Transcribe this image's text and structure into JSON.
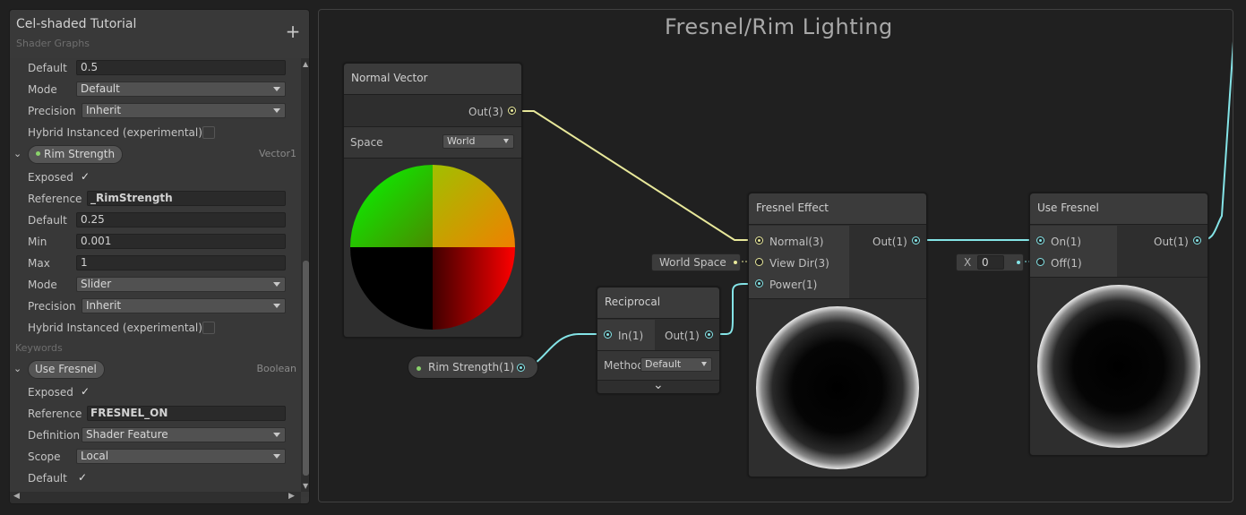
{
  "blackboard": {
    "title": "Cel-shaded Tutorial",
    "subtitle": "Shader Graphs",
    "add_icon": "+",
    "rows_top": {
      "default_label": "Default",
      "default_value": "0.5",
      "mode_label": "Mode",
      "mode_value": "Default",
      "precision_label": "Precision",
      "precision_value": "Inherit",
      "hybrid_label": "Hybrid Instanced (experimental)"
    },
    "rim_strength": {
      "name": "Rim Strength",
      "type": "Vector1",
      "exposed_label": "Exposed",
      "reference_label": "Reference",
      "reference_value": "_RimStrength",
      "default_label": "Default",
      "default_value": "0.25",
      "min_label": "Min",
      "min_value": "0.001",
      "max_label": "Max",
      "max_value": "1",
      "mode_label": "Mode",
      "mode_value": "Slider",
      "precision_label": "Precision",
      "precision_value": "Inherit",
      "hybrid_label": "Hybrid Instanced (experimental)"
    },
    "keywords_label": "Keywords",
    "use_fresnel": {
      "name": "Use Fresnel",
      "type": "Boolean",
      "exposed_label": "Exposed",
      "reference_label": "Reference",
      "reference_value": "FRESNEL_ON",
      "definition_label": "Definition",
      "definition_value": "Shader Feature",
      "scope_label": "Scope",
      "scope_value": "Local",
      "default_label": "Default"
    },
    "checkmark": "✓"
  },
  "graph": {
    "title": "Fresnel/Rim Lighting",
    "normal_vector": {
      "title": "Normal Vector",
      "out_label": "Out(3)",
      "space_label": "Space",
      "space_value": "World"
    },
    "fresnel": {
      "title": "Fresnel Effect",
      "in_normal": "Normal(3)",
      "in_viewdir": "View Dir(3)",
      "in_power": "Power(1)",
      "out_label": "Out(1)",
      "viewdir_default": "World Space"
    },
    "reciprocal": {
      "title": "Reciprocal",
      "in_label": "In(1)",
      "out_label": "Out(1)",
      "method_label": "Method",
      "method_value": "Default",
      "expand_icon": "⌄"
    },
    "rim_property": {
      "label": "Rim Strength(1)"
    },
    "use_fresnel": {
      "title": "Use Fresnel",
      "on_label": "On(1)",
      "off_label": "Off(1)",
      "out_label": "Out(1)",
      "off_default_axis": "X",
      "off_default_value": "0"
    }
  },
  "colors": {
    "vector3_wire": "#e8e89a",
    "vector1_wire": "#84e4e7",
    "property_dot": "#8ad36b"
  }
}
